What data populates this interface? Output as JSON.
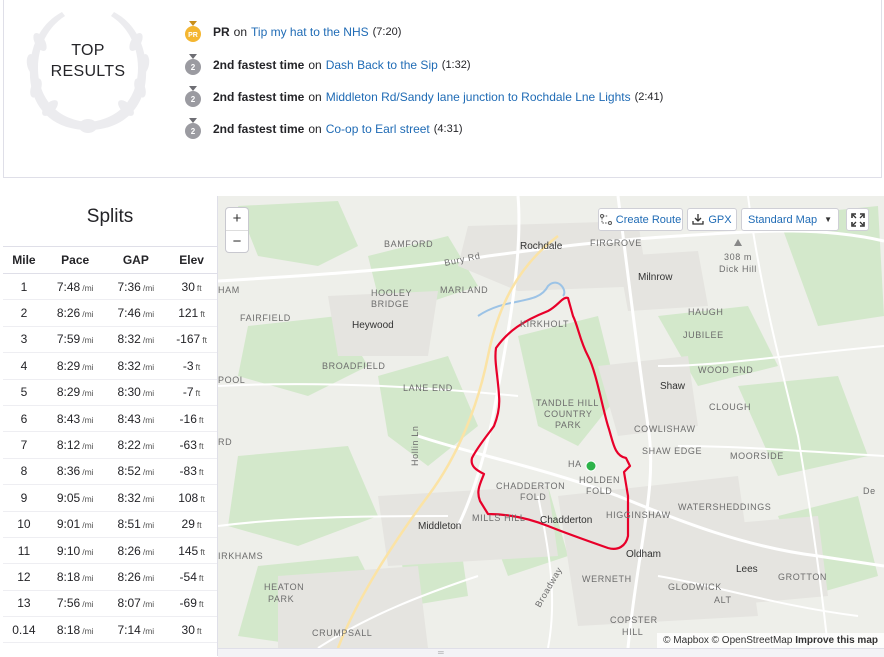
{
  "top_results": {
    "title_line1": "TOP",
    "title_line2": "RESULTS",
    "items": [
      {
        "medal": "PR",
        "label": "PR",
        "on": "on",
        "segment": "Tip my hat to the NHS",
        "time": "(7:20)"
      },
      {
        "medal": "2",
        "label": "2nd fastest time",
        "on": "on",
        "segment": "Dash Back to the Sip",
        "time": "(1:32)"
      },
      {
        "medal": "2",
        "label": "2nd fastest time",
        "on": "on",
        "segment": "Middleton Rd/Sandy lane junction to Rochdale Lne Lights",
        "time": "(2:41)"
      },
      {
        "medal": "2",
        "label": "2nd fastest time",
        "on": "on",
        "segment": "Co-op to Earl street",
        "time": "(4:31)"
      }
    ]
  },
  "splits": {
    "title": "Splits",
    "headers": [
      "Mile",
      "Pace",
      "GAP",
      "Elev"
    ],
    "pace_unit": "/mi",
    "elev_unit": "ft",
    "rows": [
      {
        "mile": "1",
        "pace": "7:48",
        "gap": "7:36",
        "elev": "30"
      },
      {
        "mile": "2",
        "pace": "8:26",
        "gap": "7:46",
        "elev": "121"
      },
      {
        "mile": "3",
        "pace": "7:59",
        "gap": "8:32",
        "elev": "-167"
      },
      {
        "mile": "4",
        "pace": "8:29",
        "gap": "8:32",
        "elev": "-3"
      },
      {
        "mile": "5",
        "pace": "8:29",
        "gap": "8:30",
        "elev": "-7"
      },
      {
        "mile": "6",
        "pace": "8:43",
        "gap": "8:43",
        "elev": "-16"
      },
      {
        "mile": "7",
        "pace": "8:12",
        "gap": "8:22",
        "elev": "-63"
      },
      {
        "mile": "8",
        "pace": "8:36",
        "gap": "8:52",
        "elev": "-83"
      },
      {
        "mile": "9",
        "pace": "9:05",
        "gap": "8:32",
        "elev": "108"
      },
      {
        "mile": "10",
        "pace": "9:01",
        "gap": "8:51",
        "elev": "29"
      },
      {
        "mile": "11",
        "pace": "9:10",
        "gap": "8:26",
        "elev": "145"
      },
      {
        "mile": "12",
        "pace": "8:18",
        "gap": "8:26",
        "elev": "-54"
      },
      {
        "mile": "13",
        "pace": "7:56",
        "gap": "8:07",
        "elev": "-69"
      },
      {
        "mile": "0.14",
        "pace": "8:18",
        "gap": "7:14",
        "elev": "30"
      }
    ]
  },
  "map": {
    "zoom_in": "+",
    "zoom_out": "−",
    "create_route": "Create Route",
    "gpx": "GPX",
    "map_style": "Standard Map",
    "attribution_1": "© Mapbox © OpenStreetMap",
    "attribution_2": "Improve this map",
    "route_color": "#e8002a",
    "start_color": "#2db34a",
    "labels": {
      "bamford": "BAMFORD",
      "rochdale": "Rochdale",
      "firgrove": "FIRGROVE",
      "bury_rd": "Bury Rd",
      "hooley": "HOOLEY",
      "bridge": "BRIDGE",
      "marland": "MARLAND",
      "milnrow": "Milnrow",
      "dick_hill_elev": "308 m",
      "dick_hill": "Dick Hill",
      "ham": "HAM",
      "fairfield": "FAIRFIELD",
      "heywood": "Heywood",
      "kirkholt": "KIRKHOLT",
      "haugh": "HAUGH",
      "jubilee": "JUBILEE",
      "broadfield": "BROADFIELD",
      "wood_end": "WOOD END",
      "pool": "POOL",
      "lane_end": "LANE END",
      "shaw": "Shaw",
      "tandle": "TANDLE HILL",
      "country": "COUNTRY",
      "park": "PARK",
      "clough": "CLOUGH",
      "cowlishaw": "COWLISHAW",
      "shaw_edge": "SHAW EDGE",
      "moorside": "MOORSIDE",
      "rd": "RD",
      "hollin": "Hollin Ln",
      "chadderton_fold": "CHADDERTON",
      "fold": "FOLD",
      "holden": "HOLDEN",
      "holden_fold": "FOLD",
      "middleton": "Middleton",
      "chadderton": "Chadderton",
      "higginshaw": "HIGGINSHAW",
      "watersheddings": "WATERSHEDDINGS",
      "irkhams": "IRKHAMS",
      "oldham": "Oldham",
      "lees": "Lees",
      "heaton": "HEATON",
      "heaton_park": "PARK",
      "werneth": "WERNETH",
      "glodwick": "GLODWICK",
      "grotton": "GROTTON",
      "crumpsall": "CRUMPSALL",
      "copster": "COPSTER",
      "hill": "HILL",
      "alt": "ALT",
      "broadway": "Broadway",
      "ha": "HA",
      "mills_hill": "MILLS HILL",
      "de": "De"
    }
  }
}
